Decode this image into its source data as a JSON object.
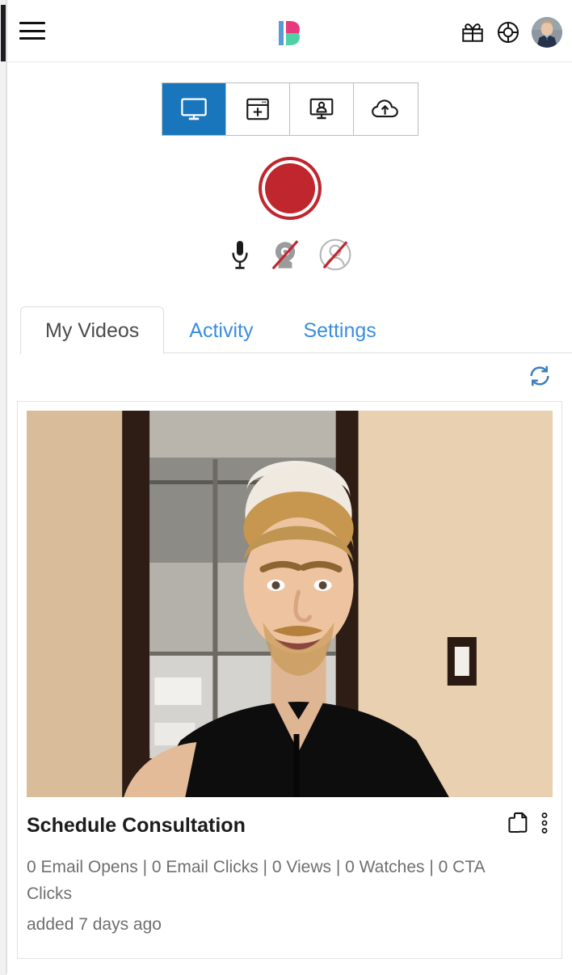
{
  "header": {
    "menu_label": "Menu",
    "logo_name": "Dubb",
    "gift_label": "Rewards",
    "help_label": "Help",
    "avatar_label": "Account",
    "logo_colors": {
      "bar": "#5b9bd5",
      "top": "#e8397f",
      "bottom": "#4fd1a5"
    }
  },
  "recorder": {
    "modes": [
      {
        "id": "screen",
        "label": "Screen",
        "icon": "monitor-icon",
        "active": true
      },
      {
        "id": "browser-tab",
        "label": "Browser Tab",
        "icon": "window-plus-icon",
        "active": false
      },
      {
        "id": "screen-cam",
        "label": "Screen + Cam",
        "icon": "monitor-person-icon",
        "active": false
      },
      {
        "id": "upload",
        "label": "Upload",
        "icon": "cloud-upload-icon",
        "active": false
      }
    ],
    "record_button_label": "Record",
    "record_button_color": "#c0262e",
    "toggles": [
      {
        "id": "microphone",
        "label": "Microphone",
        "icon": "microphone-icon",
        "enabled": true
      },
      {
        "id": "webcam",
        "label": "Webcam",
        "icon": "webcam-icon",
        "enabled": false
      },
      {
        "id": "avatar-overlay",
        "label": "Face Overlay",
        "icon": "person-circle-icon",
        "enabled": false
      }
    ]
  },
  "tabs": [
    {
      "label": "My Videos",
      "active": true
    },
    {
      "label": "Activity",
      "active": false
    },
    {
      "label": "Settings",
      "active": false
    }
  ],
  "videos_panel": {
    "refresh_label": "Refresh",
    "refresh_color": "#3a7fc1",
    "items": [
      {
        "title": "Schedule Consultation",
        "stats": "0 Email Opens | 0 Email Clicks | 0 Views | 0 Watches | 0 CTA Clicks",
        "added": "added 7 days ago",
        "copy_label": "Copy link",
        "more_label": "More options",
        "thumbnail_alt": "Man in black polo shirt smiling in an office"
      }
    ]
  }
}
